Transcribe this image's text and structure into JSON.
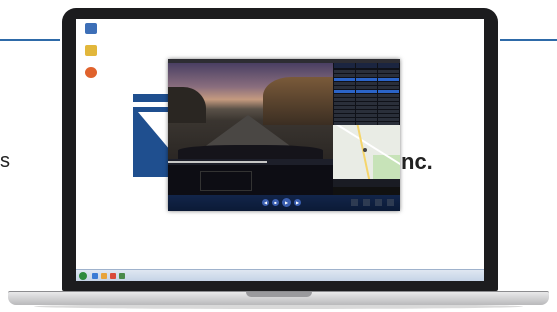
{
  "background": {
    "left_text": "s",
    "logo_text": "nc."
  },
  "desktop": {
    "icons": [
      {
        "name": "recycle-bin-icon",
        "label": "",
        "color": "#3d6fb7"
      },
      {
        "name": "folder-icon",
        "label": "",
        "color": "#e2b73b"
      },
      {
        "name": "app-shortcut-icon",
        "label": "",
        "color": "#e0622c"
      }
    ]
  },
  "app": {
    "speed": "",
    "sidebar_tabs": [
      "",
      "",
      ""
    ],
    "file_rows": 14,
    "selected_rows": [
      2,
      5
    ],
    "gps_text": "",
    "progress": 0.6
  },
  "colors": {
    "brand": "#1f4f8f",
    "accent_line": "#2e6aa8",
    "app_controls": "#12254a"
  }
}
